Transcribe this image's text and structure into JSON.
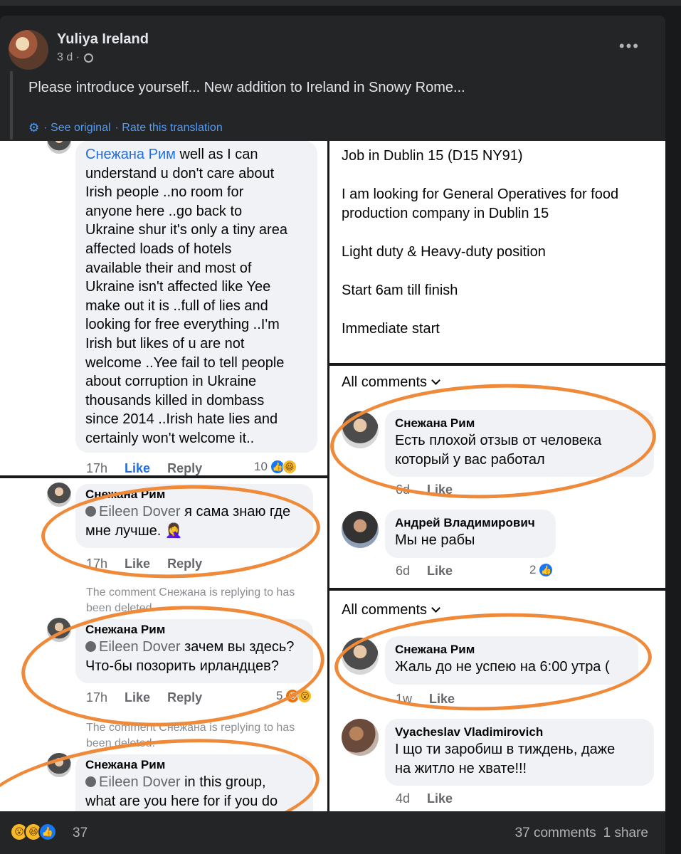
{
  "post": {
    "author": "Yuliya Ireland",
    "time": "3 d ·",
    "text": "Please introduce yourself... New addition to Ireland in Snowy Rome...",
    "see_original": "· See original",
    "rate_translation": "· Rate this translation"
  },
  "left_top": {
    "mention": "Снежана Рим",
    "lines": [
      "well as I can",
      "understand  u don't care about",
      "Irish people ..no room for",
      "anyone here ..go back to",
      "Ukraine shur it's only a tiny area",
      "affected loads of  hotels",
      "available their and  most of",
      "Ukraine isn't affected like Yee",
      "make out it is ..full of lies and",
      "looking for free everything ..I'm",
      "Irish but likes of u are not",
      "welcome ..Yee fail to tell people",
      "about corruption in Ukraine",
      "thousands killed in dombass",
      "since 2014  ..Irish hate lies and",
      "certainly won't welcome it.."
    ],
    "time": "17h",
    "like": "Like",
    "reply": "Reply",
    "reaction_count": "10"
  },
  "right_top": {
    "lines": [
      "Job in Dublin 15 (D15 NY91)",
      "I am looking for General Operatives for food",
      "production company in Dublin 15",
      "Light duty & Heavy-duty position",
      "Start 6am till finish",
      "Immediate start"
    ]
  },
  "left_bot": {
    "c1": {
      "name": "Снежана Рим",
      "mention": "Eileen Dover",
      "text1": "я сама знаю где",
      "text2": "мне лучше. 🤦‍♀️",
      "time": "17h",
      "like": "Like",
      "reply": "Reply"
    },
    "deleted1": [
      "The comment Снежана is replying to has",
      "been deleted."
    ],
    "c2": {
      "name": "Снежана Рим",
      "mention": "Eileen Dover",
      "text1": "зачем вы здесь?",
      "text2": "Что-бы позорить ирландцев?",
      "time": "17h",
      "like": "Like",
      "reply": "Reply",
      "reaction_count": "5"
    },
    "deleted2": [
      "The comment Снежана is replying to has",
      "been deleted."
    ],
    "c3": {
      "name": "Снежана Рим",
      "mention": "Eileen Dover",
      "text1": "in this group,",
      "text2": "what are you here for if you do"
    }
  },
  "right_mid": {
    "all_comments": "All comments",
    "c1": {
      "name": "Снежана Рим",
      "text1": "Есть плохой отзыв от человека",
      "text2": "который у вас работал",
      "time": "6d",
      "like": "Like"
    },
    "c2": {
      "name": "Андрей Владимирович",
      "text1": "Мы не рабы",
      "time": "6d",
      "like": "Like",
      "reaction_count": "2"
    }
  },
  "right_bot": {
    "all_comments": "All comments",
    "c1": {
      "name": "Снежана Рим",
      "text1": "Жаль до не успею на 6:00 утра (",
      "time": "1w",
      "like": "Like"
    },
    "c2": {
      "name": "Vyacheslav Vladimirovich",
      "text1": "І що ти заробиш в тиждень, даже",
      "text2": "на житло не хвате!!!",
      "time": "4d",
      "like": "Like"
    }
  },
  "footer": {
    "reaction_count": "37",
    "comments": "37 comments",
    "shares": "1 share"
  },
  "colors": {
    "annotation_circle": "#ee8a3a",
    "link_blue": "#216fdb",
    "dark_bg": "#242526"
  }
}
